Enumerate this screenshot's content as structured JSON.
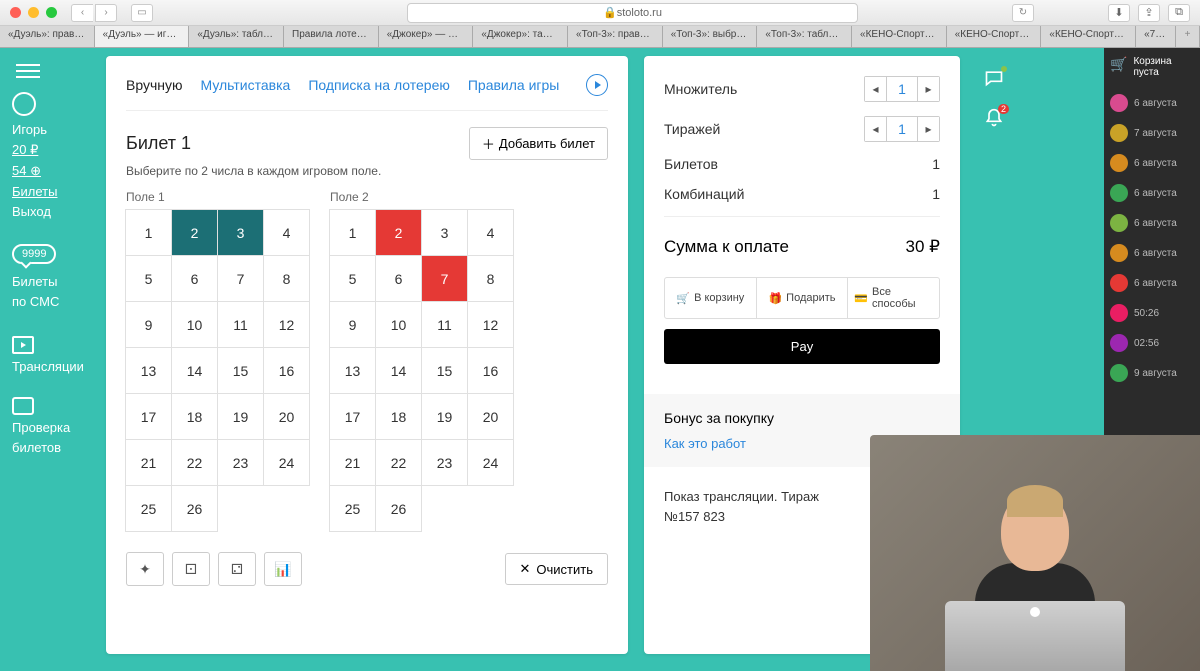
{
  "browser": {
    "url": "stoloto.ru",
    "tabs": [
      "«Дуэль»: прав…",
      "«Дуэль» — иг…",
      "«Дуэль»: табл…",
      "Правила лоте…",
      "«Джокер» — …",
      "«Джокер»: та…",
      "«Топ-3»: прав…",
      "«Топ-3»: выбр…",
      "«Топ-3»: табл…",
      "«КЕНО-Спорт…",
      "«КЕНО-Спорт…",
      "«КЕНО-Спорт…",
      "«7 и…"
    ]
  },
  "sidebar": {
    "user": "Игорь",
    "balance": "20 ₽",
    "points": "54 ⊕",
    "tickets": "Билеты",
    "logout": "Выход",
    "sms_badge": "9999",
    "sms_label1": "Билеты",
    "sms_label2": "по СМС",
    "broadcasts": "Трансляции",
    "check1": "Проверка",
    "check2": "билетов"
  },
  "menu": {
    "manual": "Вручную",
    "multi": "Мультиставка",
    "subscribe": "Подписка на лотерею",
    "rules": "Правила игры"
  },
  "ticket": {
    "title": "Билет 1",
    "add": "Добавить билет",
    "hint": "Выберите по 2 числа в каждом игровом поле.",
    "field1": "Поле 1",
    "field2": "Поле 2",
    "numbers": [
      "1",
      "2",
      "3",
      "4",
      "5",
      "6",
      "7",
      "8",
      "9",
      "10",
      "11",
      "12",
      "13",
      "14",
      "15",
      "16",
      "17",
      "18",
      "19",
      "20",
      "21",
      "22",
      "23",
      "24",
      "25",
      "26"
    ],
    "selected1": [
      2,
      3
    ],
    "selected2": [
      2,
      7
    ],
    "clear": "Очистить"
  },
  "summary": {
    "multiplier_label": "Множитель",
    "multiplier": "1",
    "draws_label": "Тиражей",
    "draws": "1",
    "tickets_label": "Билетов",
    "tickets": "1",
    "combos_label": "Комбинаций",
    "combos": "1",
    "total_label": "Сумма к оплате",
    "total": "30 ₽",
    "to_cart": "В корзину",
    "gift": "Подарить",
    "all_methods": "Все способы",
    "apple_pay": " Pay",
    "bonus_title": "Бонус за покупку",
    "bonus_link": "Как это работ",
    "broadcast_line1": "Показ трансляции. Тираж",
    "broadcast_line2": "№157 823"
  },
  "notifications": {
    "count": "2"
  },
  "cart": {
    "title1": "Корзина",
    "title2": "пуста",
    "items": [
      {
        "color": "#d94b8f",
        "label": "6 августа"
      },
      {
        "color": "#c9a227",
        "label": "7 августа"
      },
      {
        "color": "#d68b1f",
        "label": "6 августа"
      },
      {
        "color": "#3aa655",
        "label": "6 августа"
      },
      {
        "color": "#7cb342",
        "label": "6 августа"
      },
      {
        "color": "#d68b1f",
        "label": "6 августа"
      },
      {
        "color": "#e53935",
        "label": "6 августа"
      },
      {
        "color": "#e91e63",
        "label": "50:26"
      },
      {
        "color": "#9c27b0",
        "label": "02:56"
      },
      {
        "color": "#3aa655",
        "label": "9 августа"
      }
    ]
  }
}
